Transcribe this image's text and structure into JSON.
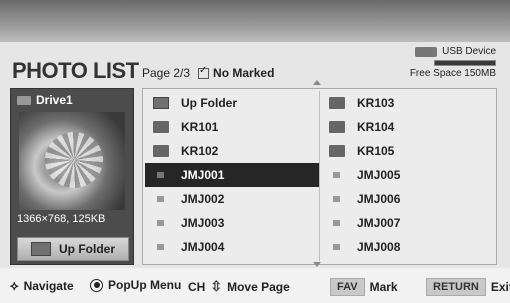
{
  "header": {
    "title": "PHOTO LIST",
    "page": "Page 2/3",
    "marked": "No Marked"
  },
  "usb": {
    "label": "USB Device",
    "free_space": "Free Space 150MB"
  },
  "drive": {
    "name": "Drive1",
    "resolution": "1366×768, 125KB",
    "up_folder_label": "Up Folder"
  },
  "files": {
    "left": [
      {
        "label": "Up Folder",
        "type": "up-folder"
      },
      {
        "label": "KR101",
        "type": "folder"
      },
      {
        "label": "KR102",
        "type": "folder"
      },
      {
        "label": "JMJ001",
        "type": "file",
        "selected": true
      },
      {
        "label": "JMJ002",
        "type": "file"
      },
      {
        "label": "JMJ003",
        "type": "file"
      },
      {
        "label": "JMJ004",
        "type": "file"
      }
    ],
    "right": [
      {
        "label": "KR103",
        "type": "folder"
      },
      {
        "label": "KR104",
        "type": "folder"
      },
      {
        "label": "KR105",
        "type": "folder"
      },
      {
        "label": "JMJ005",
        "type": "file"
      },
      {
        "label": "JMJ006",
        "type": "file"
      },
      {
        "label": "JMJ007",
        "type": "file"
      },
      {
        "label": "JMJ008",
        "type": "file"
      }
    ]
  },
  "footer": {
    "navigate": "Navigate",
    "popup": "PopUp Menu",
    "ch": "CH",
    "move_page": "Move Page",
    "fav_key": "FAV",
    "mark": "Mark",
    "return_key": "RETURN",
    "exit": "Exit"
  },
  "colors": {
    "selected_bg": "#262626",
    "drive_panel": "#4c4c4c"
  }
}
